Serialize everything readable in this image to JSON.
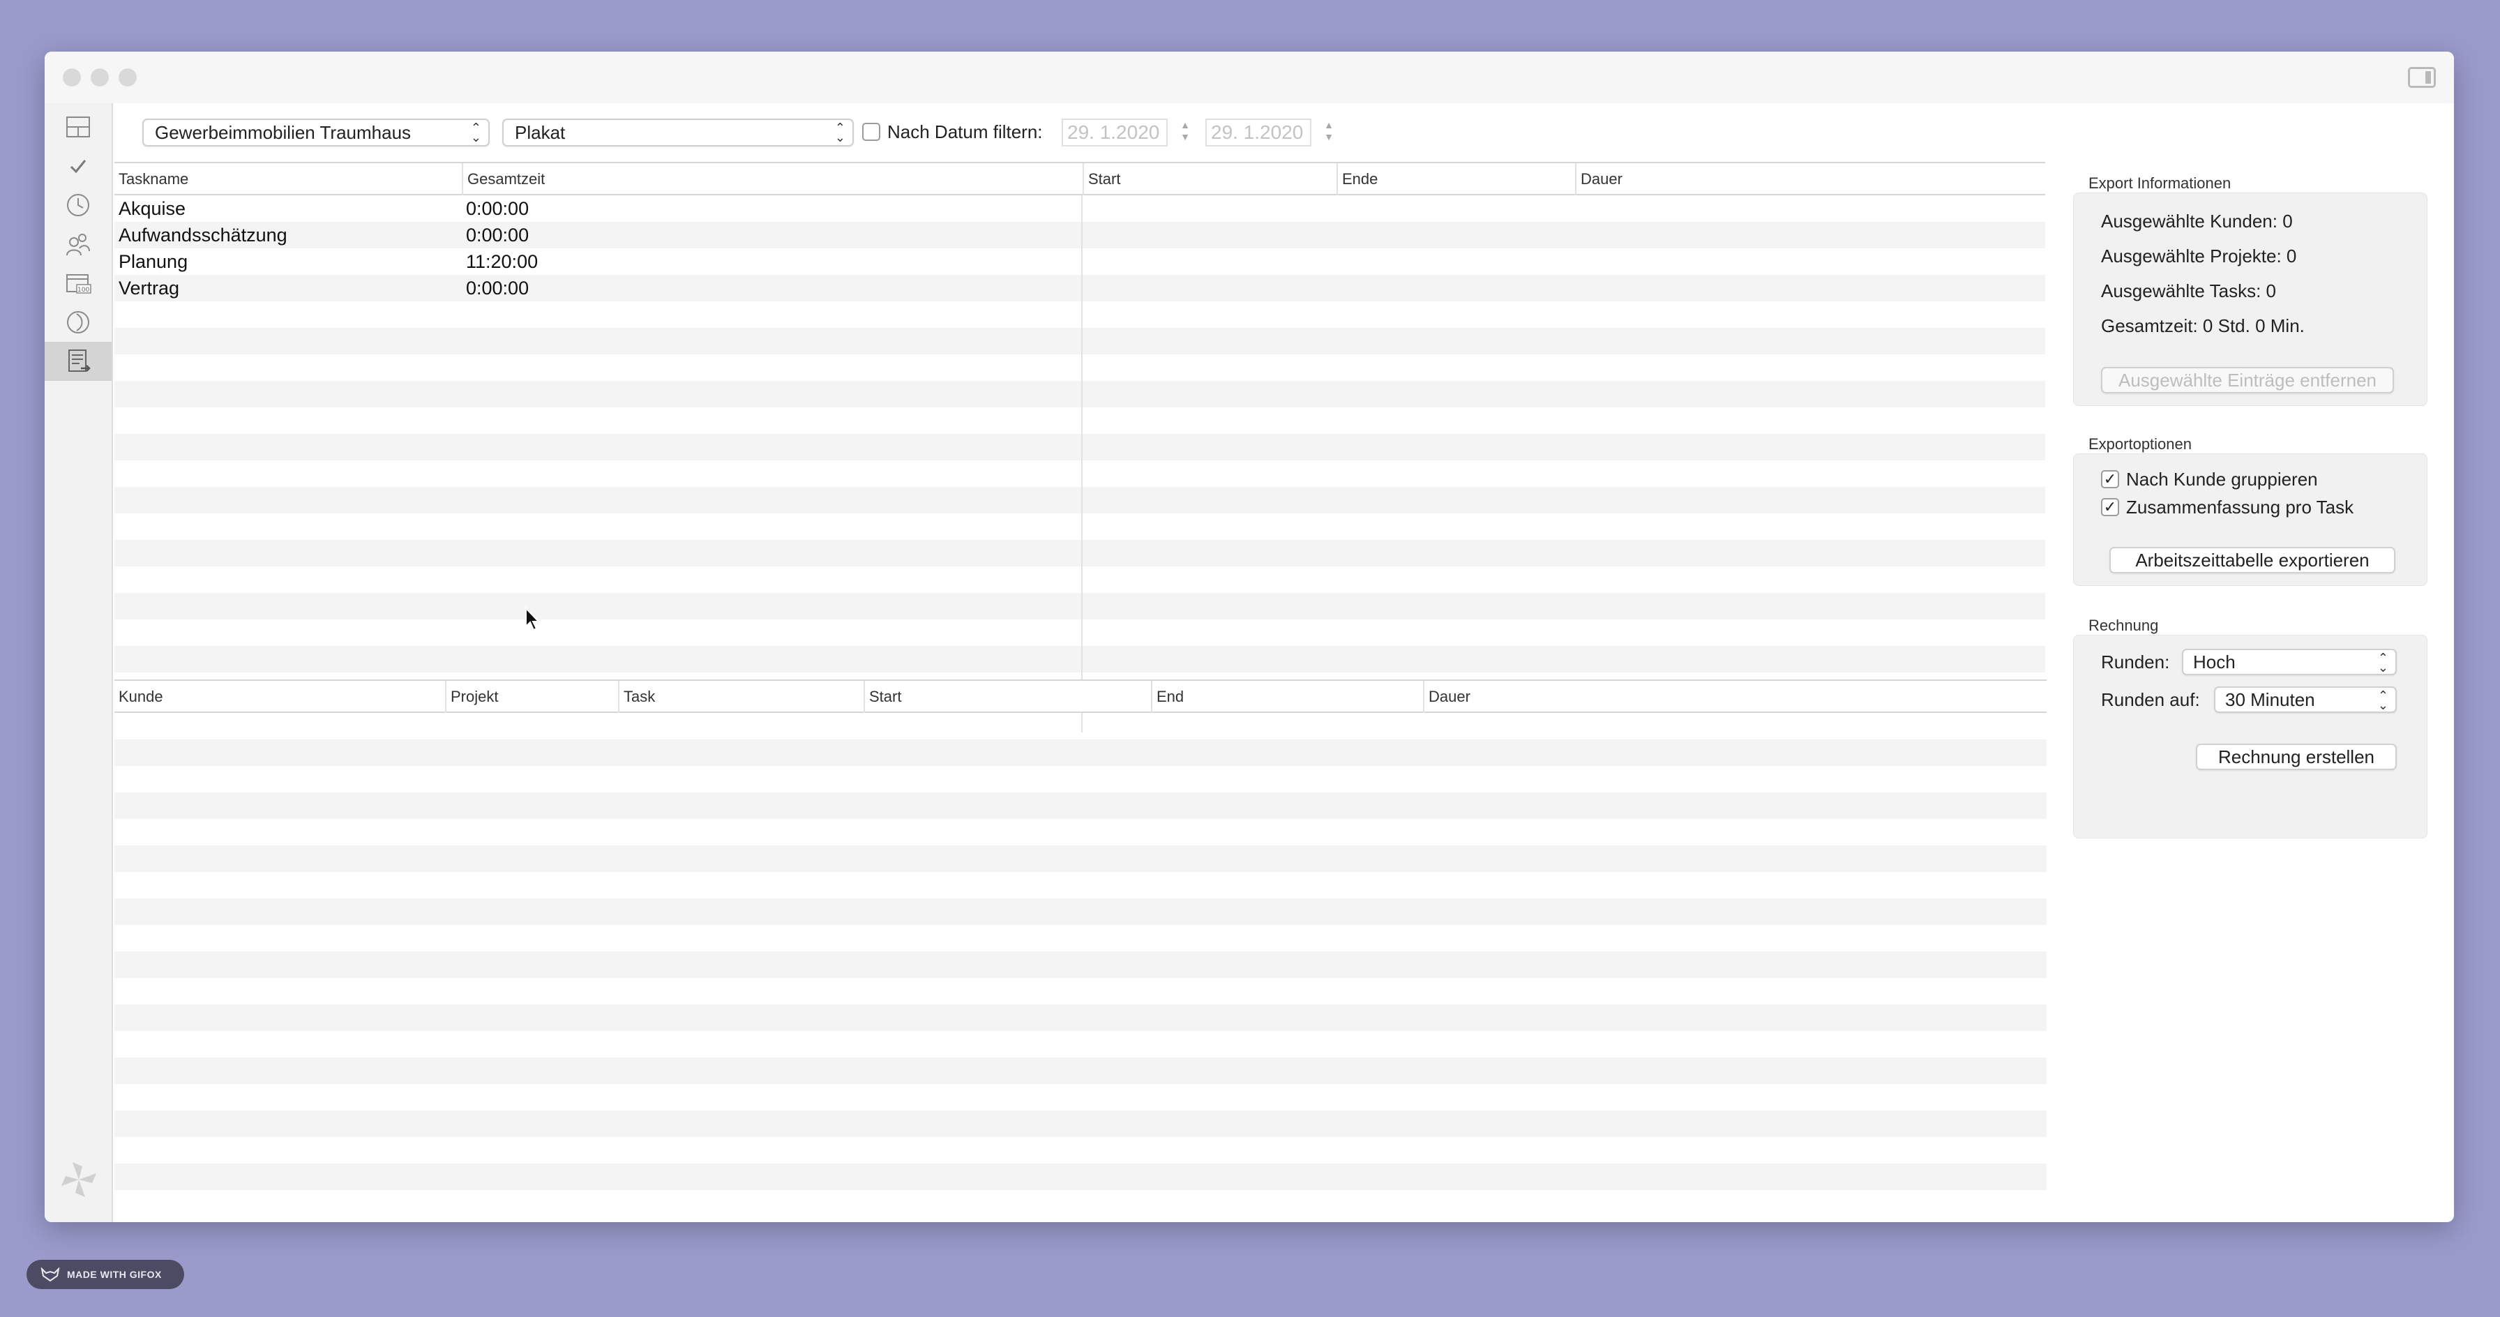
{
  "toolbar": {
    "customer_select": "Gewerbeimmobilien Traumhaus",
    "project_select": "Plakat",
    "date_filter_label": "Nach Datum filtern:",
    "date_filter_checked": false,
    "date_from": "29.  1.2020",
    "date_to": "29.  1.2020"
  },
  "sidebar": {
    "items": [
      {
        "icon": "dashboard-icon"
      },
      {
        "icon": "checkmark-icon"
      },
      {
        "icon": "clock-icon"
      },
      {
        "icon": "people-icon"
      },
      {
        "icon": "calendar-100-icon"
      },
      {
        "icon": "moon-icon"
      },
      {
        "icon": "export-document-icon",
        "active": true
      }
    ],
    "bottom_icon": "pinwheel-icon"
  },
  "tasks_table": {
    "columns": [
      "Taskname",
      "Gesamtzeit",
      "Start",
      "Ende",
      "Dauer"
    ],
    "rows": [
      {
        "name": "Akquise",
        "total": "0:00:00"
      },
      {
        "name": "Aufwandsschätzung",
        "total": "0:00:00"
      },
      {
        "name": "Planung",
        "total": "11:20:00"
      },
      {
        "name": "Vertrag",
        "total": "0:00:00"
      }
    ]
  },
  "entries_table": {
    "columns": [
      "Kunde",
      "Projekt",
      "Task",
      "Start",
      "End",
      "Dauer"
    ],
    "rows": []
  },
  "export_info": {
    "title": "Export Informationen",
    "customers": "Ausgewählte Kunden: 0",
    "projects": "Ausgewählte Projekte: 0",
    "tasks": "Ausgewählte Tasks: 0",
    "total_time": "Gesamtzeit: 0 Std. 0 Min.",
    "remove_button": "Ausgewählte Einträge entfernen"
  },
  "export_options": {
    "title": "Exportoptionen",
    "group_by_customer": {
      "label": "Nach Kunde gruppieren",
      "checked": true
    },
    "summary_per_task": {
      "label": "Zusammenfassung pro Task",
      "checked": true
    },
    "export_button": "Arbeitszeittabelle exportieren"
  },
  "invoice": {
    "title": "Rechnung",
    "rounding_label": "Runden:",
    "rounding_value": "Hoch",
    "round_to_label": "Runden auf:",
    "round_to_value": "30 Minuten",
    "create_button": "Rechnung erstellen"
  },
  "watermark": {
    "text": "MADE WITH GIFOX"
  }
}
